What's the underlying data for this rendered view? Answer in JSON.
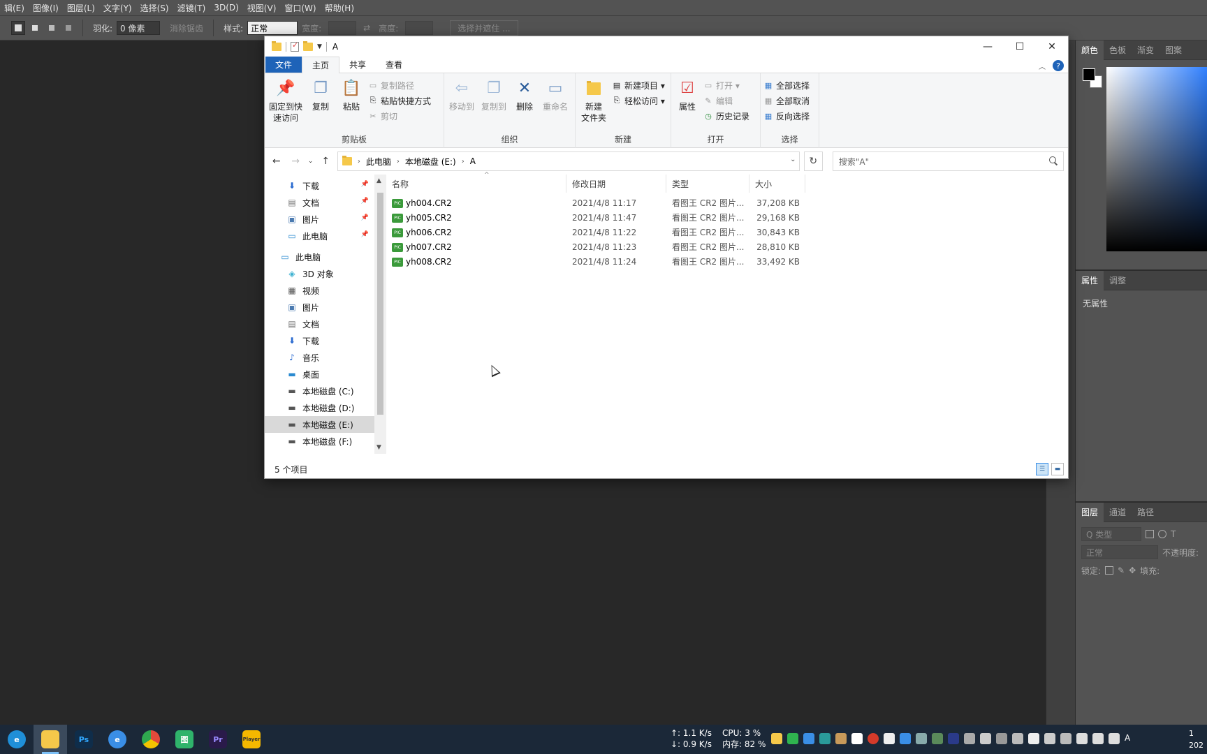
{
  "ps": {
    "menu": [
      "辑(E)",
      "图像(I)",
      "图层(L)",
      "文字(Y)",
      "选择(S)",
      "滤镜(T)",
      "3D(D)",
      "视图(V)",
      "窗口(W)",
      "帮助(H)"
    ],
    "options": {
      "feather_label": "羽化:",
      "feather_value": "0 像素",
      "antialias_label": "消除锯齿",
      "style_label": "样式:",
      "style_value": "正常",
      "width_label": "宽度:",
      "height_label": "高度:",
      "select_mask_button": "选择并遮住 ..."
    },
    "color_tabs": [
      "颜色",
      "色板",
      "渐变",
      "图案"
    ],
    "props_tabs": [
      "属性",
      "调整"
    ],
    "props_body": "无属性",
    "layers_tabs": [
      "图层",
      "通道",
      "路径"
    ],
    "layers_kind": "Q 类型",
    "layers_blend": "正常",
    "layers_opacity": "不透明度:",
    "layers_lock": "锁定:",
    "layers_fill": "填充:"
  },
  "explorer": {
    "title": "A",
    "tabs": [
      "文件",
      "主页",
      "共享",
      "查看"
    ],
    "ribbon": {
      "clipboard": {
        "label": "剪贴板",
        "pin": "固定到快\n速访问",
        "copy": "复制",
        "paste": "粘贴",
        "copy_path": "复制路径",
        "paste_shortcut": "粘贴快捷方式",
        "cut": "剪切"
      },
      "organize": {
        "label": "组织",
        "move_to": "移动到",
        "copy_to": "复制到",
        "delete": "删除",
        "rename": "重命名"
      },
      "new": {
        "label": "新建",
        "new_folder": "新建\n文件夹",
        "new_item": "新建项目 ▾",
        "easy_access": "轻松访问 ▾"
      },
      "open": {
        "label": "打开",
        "properties": "属性",
        "open": "打开 ▾",
        "edit": "编辑",
        "history": "历史记录"
      },
      "select": {
        "label": "选择",
        "select_all": "全部选择",
        "select_none": "全部取消",
        "invert": "反向选择"
      }
    },
    "address": {
      "crumbs": [
        "此电脑",
        "本地磁盘 (E:)",
        "A"
      ]
    },
    "search_placeholder": "搜索\"A\"",
    "nav": {
      "quick": [
        "下载",
        "文档",
        "图片",
        "此电脑"
      ],
      "root": "此电脑",
      "children": [
        "3D 对象",
        "视频",
        "图片",
        "文档",
        "下载",
        "音乐",
        "桌面",
        "本地磁盘 (C:)",
        "本地磁盘 (D:)",
        "本地磁盘 (E:)",
        "本地磁盘 (F:)"
      ]
    },
    "columns": [
      "名称",
      "修改日期",
      "类型",
      "大小"
    ],
    "files": [
      {
        "name": "yh004.CR2",
        "date": "2021/4/8 11:17",
        "type": "看图王 CR2 图片...",
        "size": "37,208 KB"
      },
      {
        "name": "yh005.CR2",
        "date": "2021/4/8 11:47",
        "type": "看图王 CR2 图片...",
        "size": "29,168 KB"
      },
      {
        "name": "yh006.CR2",
        "date": "2021/4/8 11:22",
        "type": "看图王 CR2 图片...",
        "size": "30,843 KB"
      },
      {
        "name": "yh007.CR2",
        "date": "2021/4/8 11:23",
        "type": "看图王 CR2 图片...",
        "size": "28,810 KB"
      },
      {
        "name": "yh008.CR2",
        "date": "2021/4/8 11:24",
        "type": "看图王 CR2 图片...",
        "size": "33,492 KB"
      }
    ],
    "file_icon_text": "PIC",
    "status": "5 个项目"
  },
  "taskbar": {
    "apps": [
      {
        "name": "edge",
        "label": "e",
        "color": "#1f8fd8"
      },
      {
        "name": "file-explorer",
        "label": "",
        "color": "#f5c84a"
      },
      {
        "name": "photoshop",
        "label": "Ps",
        "color": "#0f2d4a"
      },
      {
        "name": "browser",
        "label": "e",
        "color": "#3a8ee6"
      },
      {
        "name": "chrome",
        "label": "",
        "color": "#e24a3b"
      },
      {
        "name": "image-viewer",
        "label": "图",
        "color": "#2fb36b"
      },
      {
        "name": "premiere",
        "label": "Pr",
        "color": "#2a1a4a"
      },
      {
        "name": "player",
        "label": "Player",
        "color": "#f5b800"
      }
    ],
    "net_up": "↑: 1.1 K/s",
    "net_down": "↓: 0.9 K/s",
    "cpu": "CPU: 3 %",
    "mem": "内存: 82 %",
    "clock_line1": "1",
    "clock_line2": "202"
  }
}
